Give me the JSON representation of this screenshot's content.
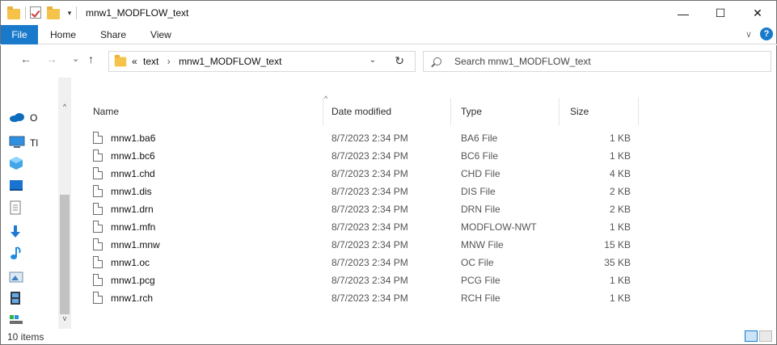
{
  "window": {
    "title": "mnw1_MODFLOW_text",
    "minimize": "—",
    "maximize": "☐",
    "close": "✕"
  },
  "ribbon": {
    "file": "File",
    "tabs": [
      "Home",
      "Share",
      "View"
    ],
    "collapse": "∨",
    "help": "?"
  },
  "nav": {
    "back": "←",
    "forward": "→",
    "recent": "⌄",
    "up": "↑",
    "address": {
      "overflow": "«",
      "crumbs": [
        "text",
        "mnw1_MODFLOW_text"
      ],
      "separator": "›",
      "dropdown": "⌄",
      "refresh": "↻"
    },
    "search_placeholder": "Search mnw1_MODFLOW_text"
  },
  "navpane": {
    "items": [
      {
        "icon": "onedrive-icon",
        "label": "O"
      },
      {
        "icon": "this-pc-icon",
        "label": "Tl"
      },
      {
        "icon": "3d-objects-icon",
        "label": ""
      },
      {
        "icon": "desktop-icon",
        "label": ""
      },
      {
        "icon": "documents-icon",
        "label": ""
      },
      {
        "icon": "downloads-icon",
        "label": ""
      },
      {
        "icon": "music-icon",
        "label": ""
      },
      {
        "icon": "pictures-icon",
        "label": ""
      },
      {
        "icon": "videos-icon",
        "label": ""
      },
      {
        "icon": "drive-icon",
        "label": ""
      }
    ],
    "scroll_up": "^",
    "scroll_down": "v"
  },
  "columns": {
    "name": "Name",
    "date": "Date modified",
    "type": "Type",
    "size": "Size",
    "sort_indicator": "^"
  },
  "files": [
    {
      "name": "mnw1.ba6",
      "date": "8/7/2023 2:34 PM",
      "type": "BA6 File",
      "size": "1 KB"
    },
    {
      "name": "mnw1.bc6",
      "date": "8/7/2023 2:34 PM",
      "type": "BC6 File",
      "size": "1 KB"
    },
    {
      "name": "mnw1.chd",
      "date": "8/7/2023 2:34 PM",
      "type": "CHD File",
      "size": "4 KB"
    },
    {
      "name": "mnw1.dis",
      "date": "8/7/2023 2:34 PM",
      "type": "DIS File",
      "size": "2 KB"
    },
    {
      "name": "mnw1.drn",
      "date": "8/7/2023 2:34 PM",
      "type": "DRN File",
      "size": "2 KB"
    },
    {
      "name": "mnw1.mfn",
      "date": "8/7/2023 2:34 PM",
      "type": "MODFLOW-NWT",
      "size": "1 KB"
    },
    {
      "name": "mnw1.mnw",
      "date": "8/7/2023 2:34 PM",
      "type": "MNW File",
      "size": "15 KB"
    },
    {
      "name": "mnw1.oc",
      "date": "8/7/2023 2:34 PM",
      "type": "OC File",
      "size": "35 KB"
    },
    {
      "name": "mnw1.pcg",
      "date": "8/7/2023 2:34 PM",
      "type": "PCG File",
      "size": "1 KB"
    },
    {
      "name": "mnw1.rch",
      "date": "8/7/2023 2:34 PM",
      "type": "RCH File",
      "size": "1 KB"
    }
  ],
  "status": {
    "count": "10 items"
  },
  "colors": {
    "accent": "#1979ca",
    "folder": "#f5c34a"
  }
}
